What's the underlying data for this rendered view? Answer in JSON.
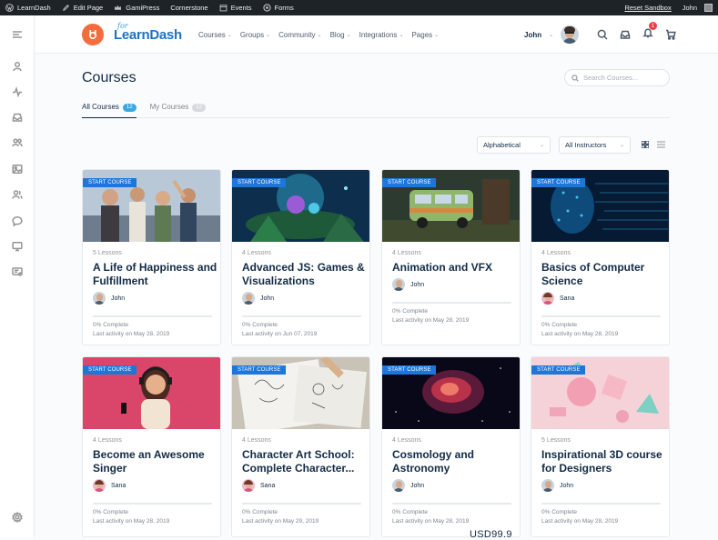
{
  "adminbar": {
    "site": "LearnDash",
    "edit_page": "Edit Page",
    "gamipress": "GamiPress",
    "cornerstone": "Cornerstone",
    "events": "Events",
    "forms": "Forms",
    "reset": "Reset Sandbox",
    "user": "John"
  },
  "logo": {
    "small": "for",
    "name": "LearnDash"
  },
  "nav": [
    {
      "label": "Courses"
    },
    {
      "label": "Groups"
    },
    {
      "label": "Community"
    },
    {
      "label": "Blog"
    },
    {
      "label": "Integrations"
    },
    {
      "label": "Pages"
    }
  ],
  "user": {
    "name": "John"
  },
  "notifications": {
    "count": "1"
  },
  "page": {
    "title": "Courses",
    "search_placeholder": "Search Courses..."
  },
  "tabs": [
    {
      "label": "All Courses",
      "count": "12"
    },
    {
      "label": "My Courses",
      "count": "12"
    }
  ],
  "filters": {
    "order": "Alphabetical",
    "instructors": "All Instructors"
  },
  "colors": {
    "accent": "#1d76da",
    "brand": "#f26c3e",
    "badge": "#38a8e2"
  },
  "courses": [
    {
      "ribbon": "START COURSE",
      "lessons": "5 Lessons",
      "title": "A Life of Happiness and Fulfillment",
      "author": "John",
      "progress": 0,
      "complete": "0% Complete",
      "activity": "Last activity on May 28, 2019"
    },
    {
      "ribbon": "START COURSE",
      "lessons": "4 Lessons",
      "title": "Advanced JS: Games & Visualizations",
      "author": "John",
      "progress": 0,
      "complete": "0% Complete",
      "activity": "Last activity on Jun 07, 2019"
    },
    {
      "ribbon": "START COURSE",
      "lessons": "4 Lessons",
      "title": "Animation and VFX",
      "author": "John",
      "progress": 0,
      "complete": "0% Complete",
      "activity": "Last activity on May 28, 2019"
    },
    {
      "ribbon": "START COURSE",
      "lessons": "4 Lessons",
      "title": "Basics of Computer Science",
      "author": "Sana",
      "progress": 0,
      "complete": "0% Complete",
      "activity": "Last activity on May 28, 2019"
    },
    {
      "ribbon": "START COURSE",
      "lessons": "4 Lessons",
      "title": "Become an Awesome Singer",
      "author": "Sana",
      "progress": 0,
      "complete": "0% Complete",
      "activity": "Last activity on May 28, 2019"
    },
    {
      "ribbon": "START COURSE",
      "lessons": "4 Lessons",
      "title": "Character Art School: Complete Character...",
      "author": "Sana",
      "progress": 0,
      "complete": "0% Complete",
      "activity": "Last activity on May 29, 2019"
    },
    {
      "ribbon": "START COURSE",
      "lessons": "4 Lessons",
      "title": "Cosmology and Astronomy",
      "author": "John",
      "progress": 0,
      "complete": "0% Complete",
      "activity": "Last activity on May 28, 2019"
    },
    {
      "ribbon": "START COURSE",
      "lessons": "5 Lessons",
      "title": "Inspirational 3D course for Designers",
      "author": "John",
      "progress": 0,
      "complete": "0% Complete",
      "activity": "Last activity on May 28, 2019"
    }
  ],
  "price": "USD99.9"
}
